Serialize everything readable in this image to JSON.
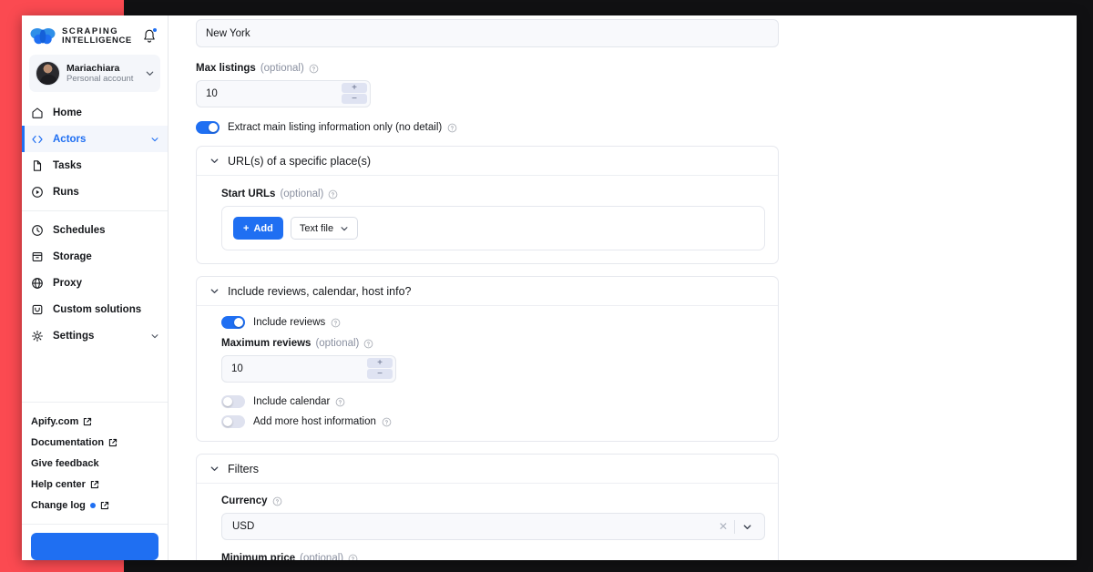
{
  "theme": {
    "accent": "#1f6ff2",
    "backdrop": "#111113",
    "red_block": "#fb4a51",
    "panel_border": "#e6e8ee",
    "input_bg": "#f8f9fc"
  },
  "sidebar": {
    "brand": {
      "line1": "SCRAPING",
      "line2": "INTELLIGENCE",
      "logo_icon": "butterfly-logo-icon",
      "bell_icon": "notification-bell-icon"
    },
    "account": {
      "name": "Mariachiara",
      "subtitle": "Personal account",
      "avatar_icon": "user-avatar",
      "chevron_icon": "chevron-down-icon"
    },
    "nav_primary": [
      {
        "label": "Home",
        "icon": "home-icon",
        "active": false,
        "caret": false
      },
      {
        "label": "Actors",
        "icon": "code-brackets-icon",
        "active": true,
        "caret": true
      },
      {
        "label": "Tasks",
        "icon": "document-icon",
        "active": false,
        "caret": false
      },
      {
        "label": "Runs",
        "icon": "play-circle-icon",
        "active": false,
        "caret": false
      }
    ],
    "nav_secondary": [
      {
        "label": "Schedules",
        "icon": "clock-icon",
        "active": false,
        "caret": false
      },
      {
        "label": "Storage",
        "icon": "archive-box-icon",
        "active": false,
        "caret": false
      },
      {
        "label": "Proxy",
        "icon": "globe-icon",
        "active": false,
        "caret": false
      },
      {
        "label": "Custom solutions",
        "icon": "inbox-icon",
        "active": false,
        "caret": false
      },
      {
        "label": "Settings",
        "icon": "gear-icon",
        "active": false,
        "caret": true
      }
    ],
    "links": [
      {
        "label": "Apify.com",
        "external": true,
        "dot": false
      },
      {
        "label": "Documentation",
        "external": true,
        "dot": false
      },
      {
        "label": "Give feedback",
        "external": false,
        "dot": false
      },
      {
        "label": "Help center",
        "external": true,
        "dot": false
      },
      {
        "label": "Change log",
        "external": true,
        "dot": true
      }
    ],
    "cta_label": ""
  },
  "form": {
    "location_input": {
      "value": "New York"
    },
    "max_listings": {
      "label": "Max listings",
      "optional": "(optional)",
      "value": "10",
      "increment_icon": "plus-icon",
      "decrement_icon": "minus-icon",
      "help_icon": "question-circle-icon"
    },
    "extract_main_only": {
      "label": "Extract main listing information only (no detail)",
      "state": "on",
      "help_icon": "question-circle-icon"
    },
    "panels": [
      {
        "title": "URL(s) of a specific place(s)",
        "caret_icon": "chevron-down-icon",
        "start_urls": {
          "label": "Start URLs",
          "optional": "(optional)",
          "add_label": "Add",
          "add_icon": "plus-icon",
          "source_label": "Text file",
          "source_caret": "chevron-down-icon",
          "help_icon": "question-circle-icon"
        }
      },
      {
        "title": "Include reviews, calendar, host info?",
        "caret_icon": "chevron-down-icon",
        "include_reviews": {
          "label": "Include reviews",
          "state": "on",
          "help_icon": "question-circle-icon"
        },
        "maximum_reviews": {
          "label": "Maximum reviews",
          "optional": "(optional)",
          "value": "10",
          "increment_icon": "plus-icon",
          "decrement_icon": "minus-icon",
          "help_icon": "question-circle-icon"
        },
        "include_calendar": {
          "label": "Include calendar",
          "state": "off",
          "help_icon": "question-circle-icon"
        },
        "add_host_info": {
          "label": "Add more host information",
          "state": "off",
          "help_icon": "question-circle-icon"
        }
      },
      {
        "title": "Filters",
        "caret_icon": "chevron-down-icon",
        "currency": {
          "label": "Currency",
          "value": "USD",
          "clear_icon": "clear-x-icon",
          "dropdown_icon": "chevron-down-icon",
          "help_icon": "question-circle-icon"
        },
        "minimum_price": {
          "label": "Minimum price",
          "optional": "(optional)",
          "help_icon": "question-circle-icon"
        }
      }
    ]
  }
}
